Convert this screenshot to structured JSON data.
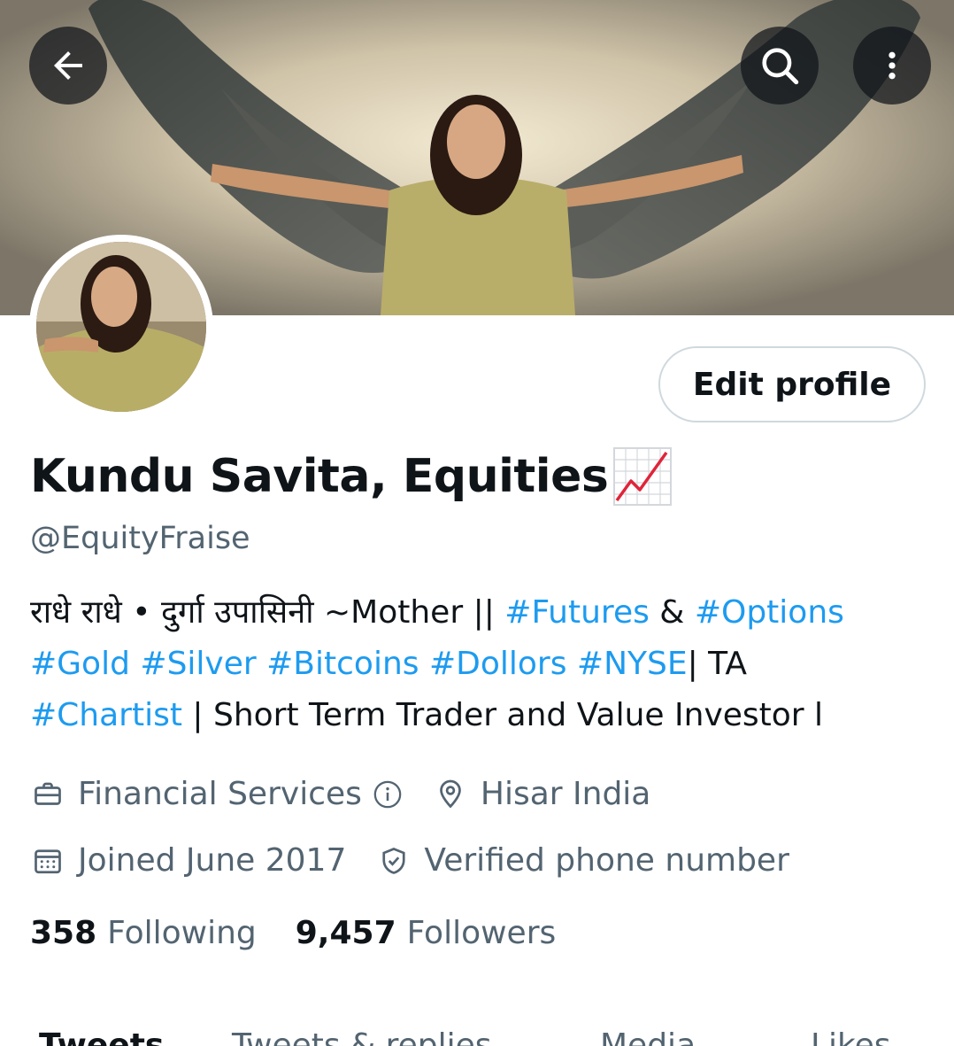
{
  "header": {
    "back_icon": "arrow-left-icon",
    "search_icon": "search-icon",
    "more_icon": "more-vertical-icon"
  },
  "profile": {
    "edit_button_label": "Edit profile",
    "display_name": "Kundu Savita, Equities",
    "name_emoji": "chart-increasing-icon",
    "handle": "@EquityFraise",
    "bio": {
      "line1": {
        "prefix": "राधे राधे • दुर्गा उपासिनी ~Mother || ",
        "tag1": "#Futures",
        "mid": " & ",
        "tag2": "#Options"
      },
      "line2": {
        "tags": [
          "#Gold",
          "#Silver",
          "#Bitcoins",
          "#Dollors",
          "#NYSE"
        ],
        "suffix": "| TA"
      },
      "line3": {
        "tag": "#Chartist",
        "suffix": " | Short Term Trader and Value Investor l"
      }
    },
    "category": "Financial Services",
    "location": "Hisar India",
    "joined": "Joined June 2017",
    "verified": "Verified phone number",
    "following_count": "358",
    "following_label": "Following",
    "followers_count": "9,457",
    "followers_label": "Followers"
  },
  "tabs": [
    "Tweets",
    "Tweets & replies",
    "Media",
    "Likes"
  ],
  "colors": {
    "link": "#1d9bf0",
    "secondary_text": "#536471",
    "primary_text": "#0f1419",
    "border": "#cfd9de"
  }
}
